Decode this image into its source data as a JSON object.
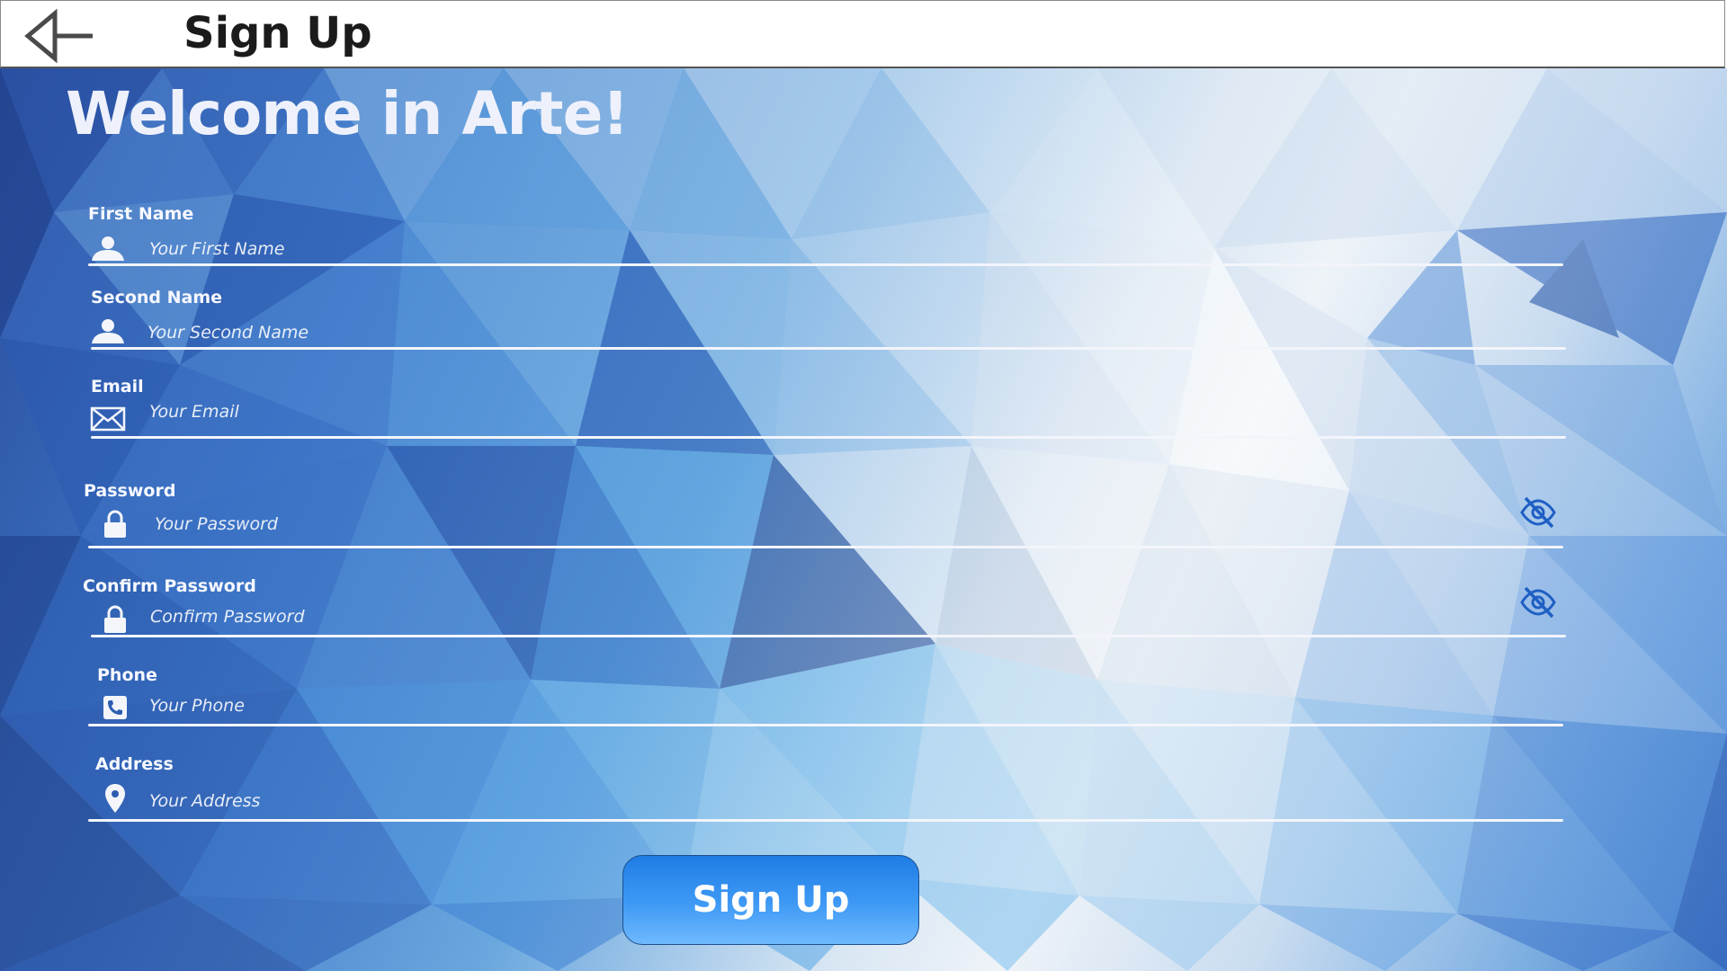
{
  "header": {
    "title": "Sign Up",
    "back_icon": "back-arrow-icon"
  },
  "welcome": "Welcome in Arte!",
  "form": {
    "first_name": {
      "label": "First Name",
      "placeholder": "Your First Name",
      "icon": "user-icon"
    },
    "second_name": {
      "label": "Second Name",
      "placeholder": "Your Second Name",
      "icon": "user-icon"
    },
    "email": {
      "label": "Email",
      "placeholder": "Your Email",
      "icon": "envelope-icon"
    },
    "password": {
      "label": "Password",
      "placeholder": "Your Password",
      "icon": "lock-icon",
      "toggle_icon": "eye-off-icon"
    },
    "confirm_password": {
      "label": "Confirm Password",
      "placeholder": "Confirm Password",
      "icon": "lock-icon",
      "toggle_icon": "eye-off-icon"
    },
    "phone": {
      "label": "Phone",
      "placeholder": "Your Phone",
      "icon": "phone-icon"
    },
    "address": {
      "label": "Address",
      "placeholder": "Your Address",
      "icon": "map-pin-icon"
    }
  },
  "submit_label": "Sign Up",
  "colors": {
    "accent": "#3f9af5",
    "eye_icon": "#1f5fc4",
    "text_light": "#f6f8ff"
  }
}
